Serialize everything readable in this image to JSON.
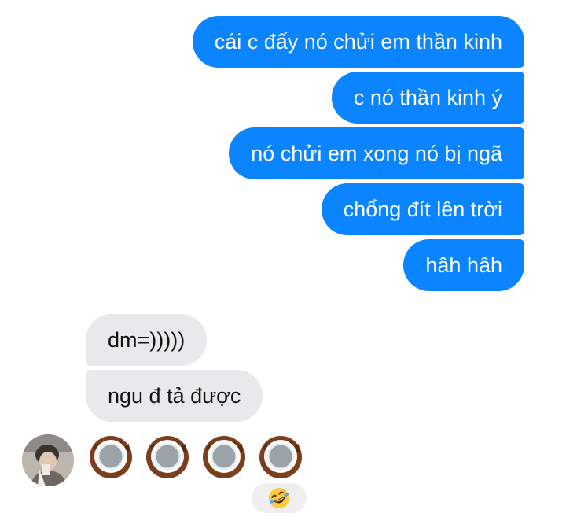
{
  "messages_sent": [
    "cái c đấy nó chửi em thần kinh",
    "c nó thần kinh ý",
    "nó chửi em xong nó bị ngã",
    "chổng đít lên trời",
    "hâh hâh"
  ],
  "messages_received": [
    "dm=)))))",
    "ngu đ tả được"
  ],
  "last_message": {
    "emojis": [
      "coconut-emoji",
      "coconut-emoji",
      "coconut-emoji",
      "coconut-emoji"
    ],
    "reaction": "rolling-on-floor-laughing-emoji"
  },
  "colors": {
    "sent_bubble": "#0a84ff",
    "received_bubble": "#e9e9eb",
    "reaction_bg": "#efefef"
  }
}
